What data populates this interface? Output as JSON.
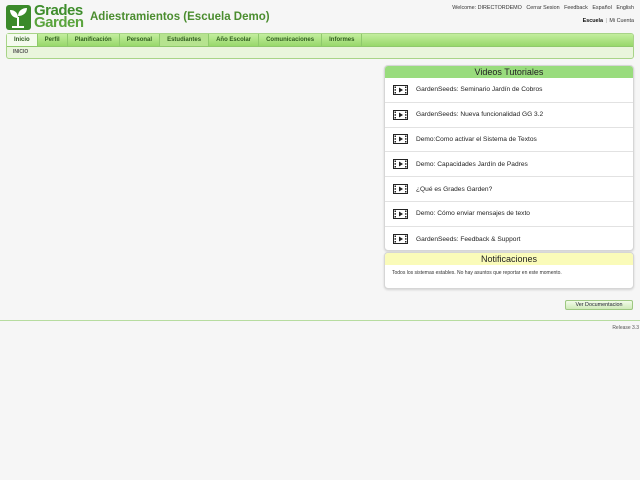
{
  "logo": {
    "line1": "Grades",
    "line2": "Garden"
  },
  "header": {
    "school_title": "Adiestramientos (Escuela Demo)"
  },
  "user_links": {
    "welcome": "Welcome: DIRECTORDEMO",
    "logout": "Cerrar Sesion",
    "feedback": "Feedback",
    "spanish": "Español",
    "english": "English"
  },
  "account_links": {
    "school": "Escuela",
    "separator": "|",
    "my_account": "Mi Cuenta"
  },
  "nav": {
    "tabs": [
      "Inicio",
      "Perfil",
      "Planificación",
      "Personal",
      "Estudiantes",
      "Año Escolar",
      "Comunicaciones",
      "Informes"
    ],
    "active_tab": "Inicio",
    "subnav": "INICIO"
  },
  "videos": {
    "title": "Videos Tutoriales",
    "items": [
      "GardenSeeds: Seminario Jardín de Cobros",
      "GardenSeeds: Nueva funcionalidad GG 3.2",
      "Demo:Como activar el Sistema de Textos",
      "Demo: Capacidades Jardín de Padres",
      "¿Qué es Grades Garden?",
      "Demo: Cómo enviar mensajes de texto",
      "GardenSeeds: Feedback & Support"
    ]
  },
  "notifications": {
    "title": "Notificaciones",
    "text": "Todos los sistemas estables. No hay asuntos que reportar en este momento."
  },
  "doc_button": "Ver Documentacion",
  "release": "Release 3.3",
  "colors": {
    "brand_green": "#3e8d2c",
    "tab_green": "#98d86b",
    "videos_header": "#99dc7d",
    "notif_header": "#fafbb9"
  }
}
